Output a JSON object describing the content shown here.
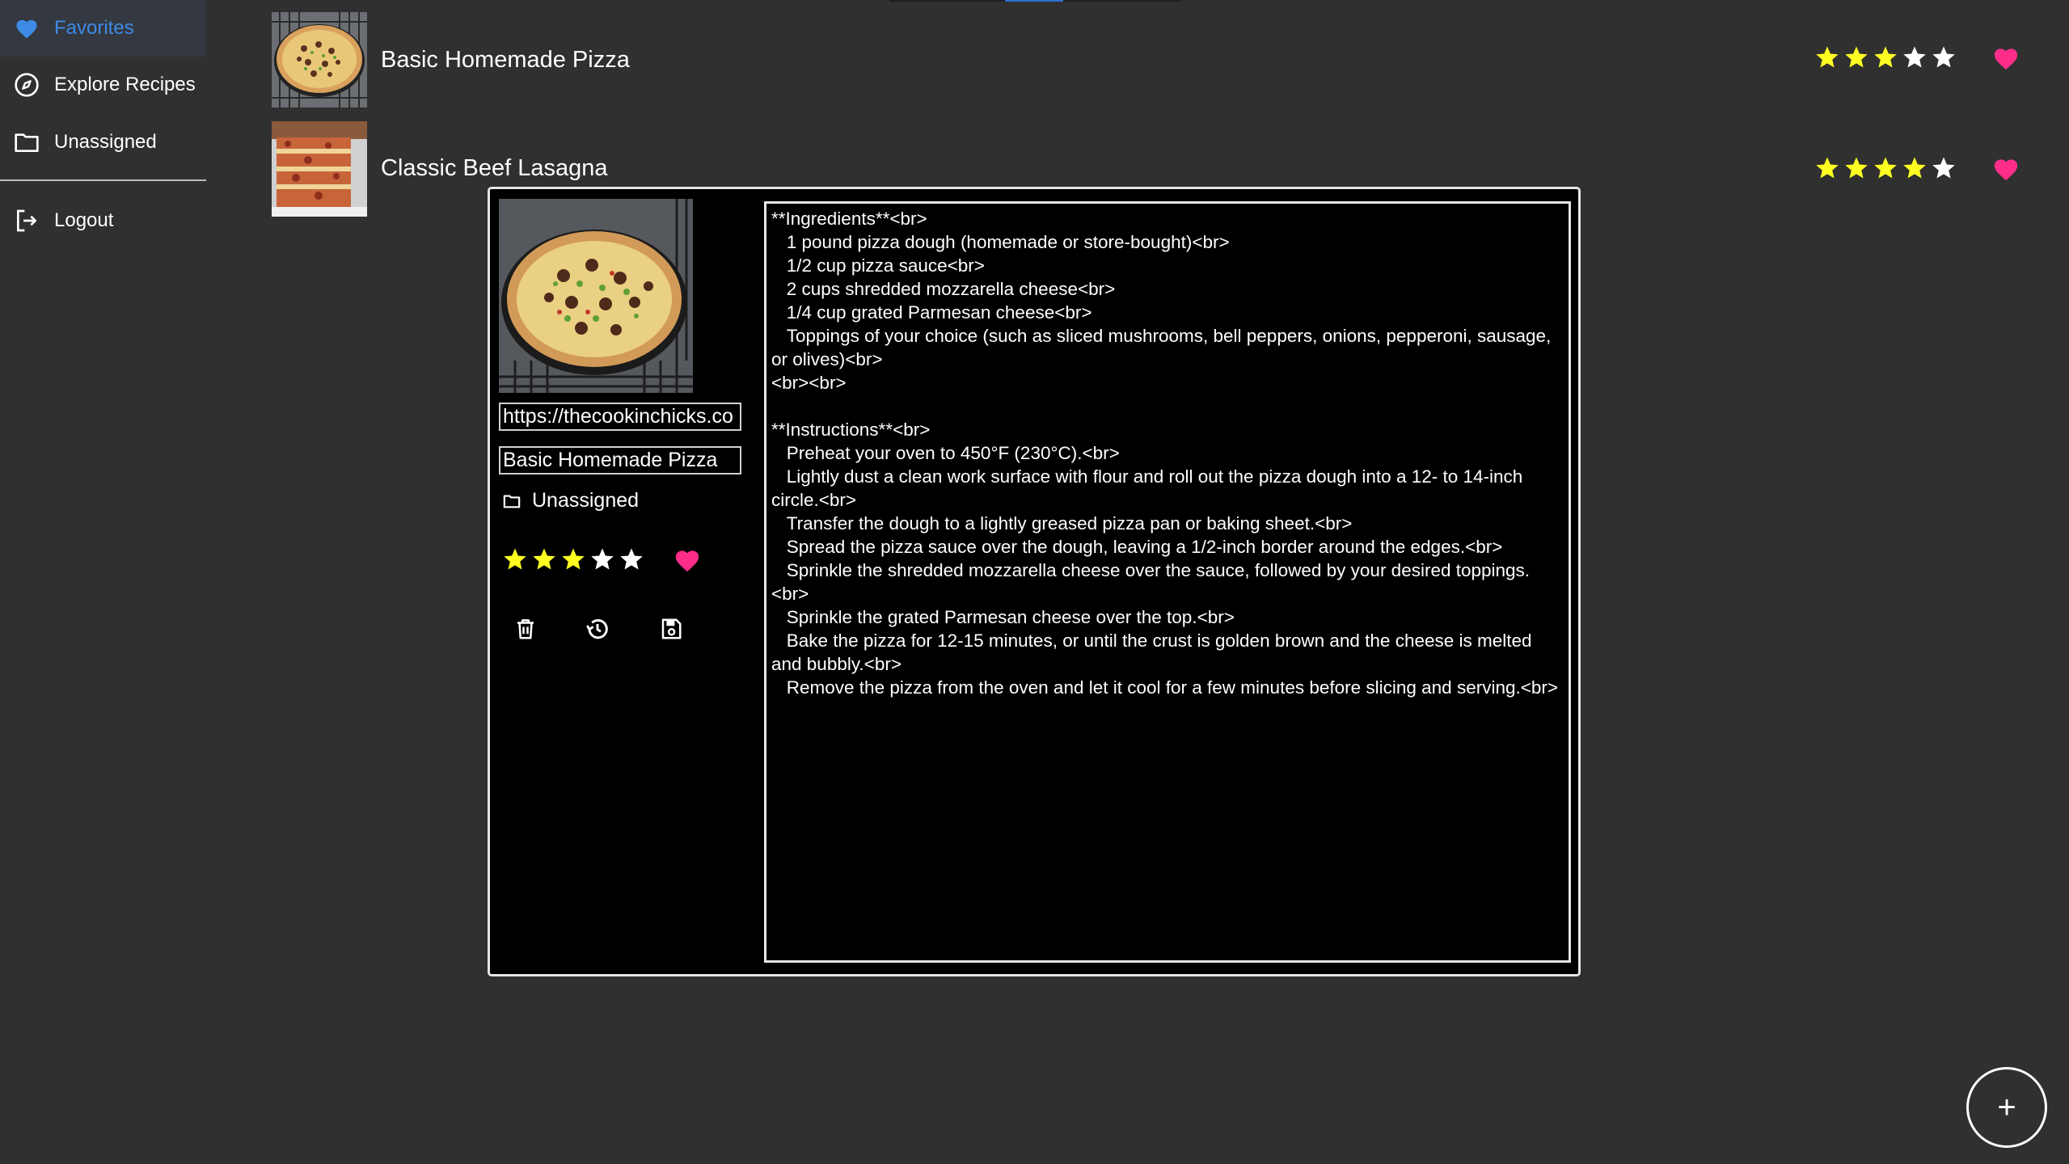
{
  "sidebar": {
    "items": [
      {
        "label": "Favorites",
        "icon": "heart-icon",
        "active": true
      },
      {
        "label": "Explore Recipes",
        "icon": "compass-icon"
      },
      {
        "label": "Unassigned",
        "icon": "folder-icon"
      },
      {
        "label": "Logout",
        "icon": "logout-icon"
      }
    ]
  },
  "recipes": [
    {
      "title": "Basic Homemade Pizza",
      "rating": 3,
      "favorite": true
    },
    {
      "title": "Classic Beef Lasagna",
      "rating": 4,
      "favorite": true
    }
  ],
  "dialog": {
    "url": "https://thecookinchicks.co",
    "name": "Basic Homemade Pizza",
    "folder": "Unassigned",
    "rating": 3,
    "favorite": true,
    "tools": [
      "delete-icon",
      "history-icon",
      "save-icon"
    ],
    "content": "**Ingredients**<br>\n   1 pound pizza dough (homemade or store-bought)<br>\n   1/2 cup pizza sauce<br>\n   2 cups shredded mozzarella cheese<br>\n   1/4 cup grated Parmesan cheese<br>\n   Toppings of your choice (such as sliced mushrooms, bell peppers, onions, pepperoni, sausage, or olives)<br>\n<br><br>\n\n**Instructions**<br>\n   Preheat your oven to 450°F (230°C).<br>\n   Lightly dust a clean work surface with flour and roll out the pizza dough into a 12- to 14-inch circle.<br>\n   Transfer the dough to a lightly greased pizza pan or baking sheet.<br>\n   Spread the pizza sauce over the dough, leaving a 1/2-inch border around the edges.<br>\n   Sprinkle the shredded mozzarella cheese over the sauce, followed by your desired toppings.<br>\n   Sprinkle the grated Parmesan cheese over the top.<br>\n   Bake the pizza for 12-15 minutes, or until the crust is golden brown and the cheese is melted and bubbly.<br>\n   Remove the pizza from the oven and let it cool for a few minutes before slicing and serving.<br>"
  },
  "fab": {
    "label": "+"
  },
  "colors": {
    "background": "#303030",
    "accent": "#3e8be6",
    "star_filled": "#ffff22",
    "star_empty": "#ffffff",
    "heart": "#ff2d8a"
  }
}
